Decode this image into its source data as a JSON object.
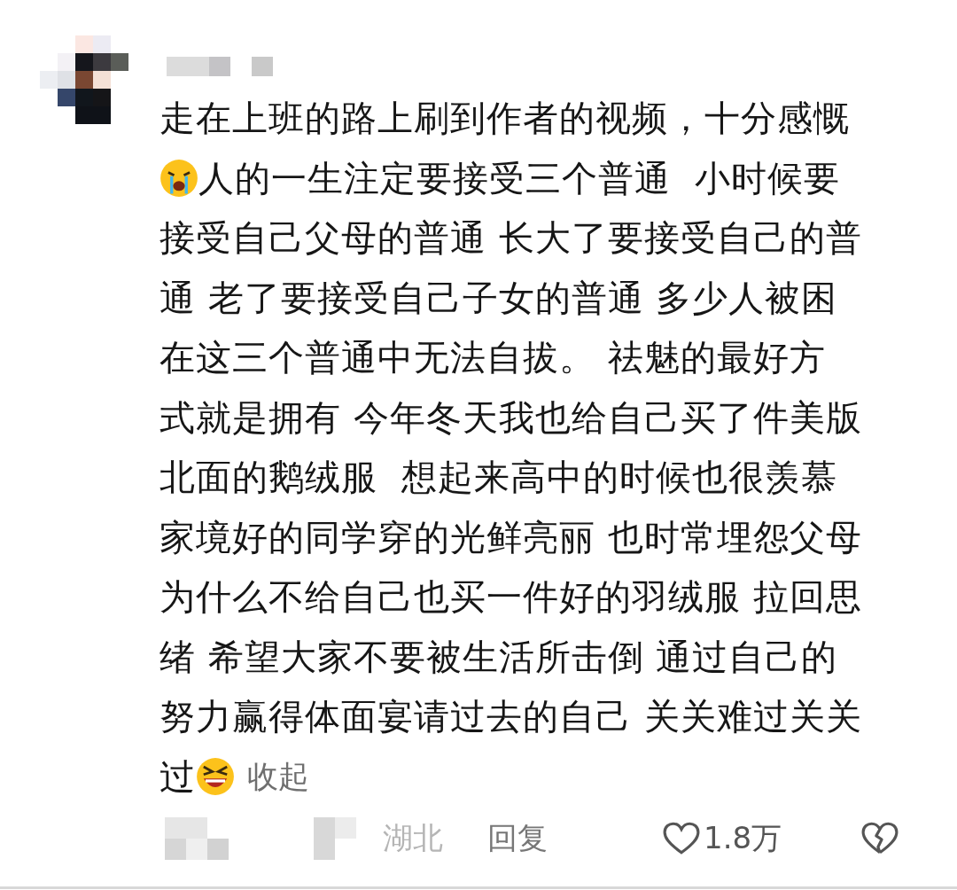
{
  "comment": {
    "lines": [
      [
        {
          "kind": "text",
          "text": "走在上班的路上刷到作者的视频，十分感慨"
        }
      ],
      [
        {
          "kind": "crying-emoji"
        },
        {
          "kind": "text",
          "text": "人的一生注定要接受三个普通  小时候要"
        }
      ],
      [
        {
          "kind": "text",
          "text": "接受自己父母的普通 长大了要接受自己的普"
        }
      ],
      [
        {
          "kind": "text",
          "text": "通 老了要接受自己子女的普通 多少人被困"
        }
      ],
      [
        {
          "kind": "text",
          "text": "在这三个普通中无法自拔。 祛魅的最好方"
        }
      ],
      [
        {
          "kind": "text",
          "text": "式就是拥有 今年冬天我也给自己买了件美版"
        }
      ],
      [
        {
          "kind": "text",
          "text": "北面的鹅绒服  想起来高中的时候也很羡慕"
        }
      ],
      [
        {
          "kind": "text",
          "text": "家境好的同学穿的光鲜亮丽 也时常埋怨父母"
        }
      ],
      [
        {
          "kind": "text",
          "text": "为什么不给自己也买一件好的羽绒服 拉回思"
        }
      ],
      [
        {
          "kind": "text",
          "text": "绪 希望大家不要被生活所击倒 通过自己的"
        }
      ],
      [
        {
          "kind": "text",
          "text": "努力赢得体面宴请过去的自己 关关难过关关"
        }
      ],
      [
        {
          "kind": "text",
          "text": "过"
        },
        {
          "kind": "grin-emoji"
        },
        {
          "kind": "link",
          "text": "收起"
        }
      ]
    ],
    "location": "湖北",
    "reply": "回复",
    "likes": "1.8万",
    "liked": false,
    "disliked": false
  }
}
